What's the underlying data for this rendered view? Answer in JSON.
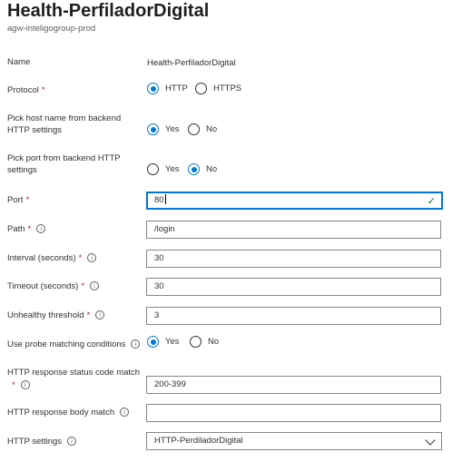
{
  "header": {
    "title": "Health-PerfiladorDigital",
    "subtitle": "agw-inteligogroup-prod"
  },
  "form": {
    "name_label": "Name",
    "name_value": "Health-PerfiladorDigital",
    "protocol_label": "Protocol",
    "protocol_options": [
      "HTTP",
      "HTTPS"
    ],
    "protocol_selected": "HTTP",
    "pick_host_label": "Pick host name from backend HTTP settings",
    "pick_host_options": [
      "Yes",
      "No"
    ],
    "pick_host_selected": "Yes",
    "pick_port_label": "Pick port from backend HTTP settings",
    "pick_port_options": [
      "Yes",
      "No"
    ],
    "pick_port_selected": "No",
    "port_label": "Port",
    "port_value": "80",
    "path_label": "Path",
    "path_value": "/login",
    "interval_label": "Interval (seconds)",
    "interval_value": "30",
    "timeout_label": "Timeout (seconds)",
    "timeout_value": "30",
    "unhealthy_label": "Unhealthy threshold",
    "unhealthy_value": "3",
    "matching_label": "Use probe matching conditions",
    "matching_options": [
      "Yes",
      "No"
    ],
    "matching_selected": "Yes",
    "status_code_label": "HTTP response status code match",
    "status_code_value": "200-399",
    "body_match_label": "HTTP response body match",
    "body_match_value": "",
    "http_settings_label": "HTTP settings",
    "http_settings_value": "HTTP-PerdiladorDigital",
    "required_mark": "*",
    "info_glyph": "i"
  },
  "colors": {
    "accent": "#0078d4",
    "required": "#a4262c",
    "valid": "#107c10"
  }
}
